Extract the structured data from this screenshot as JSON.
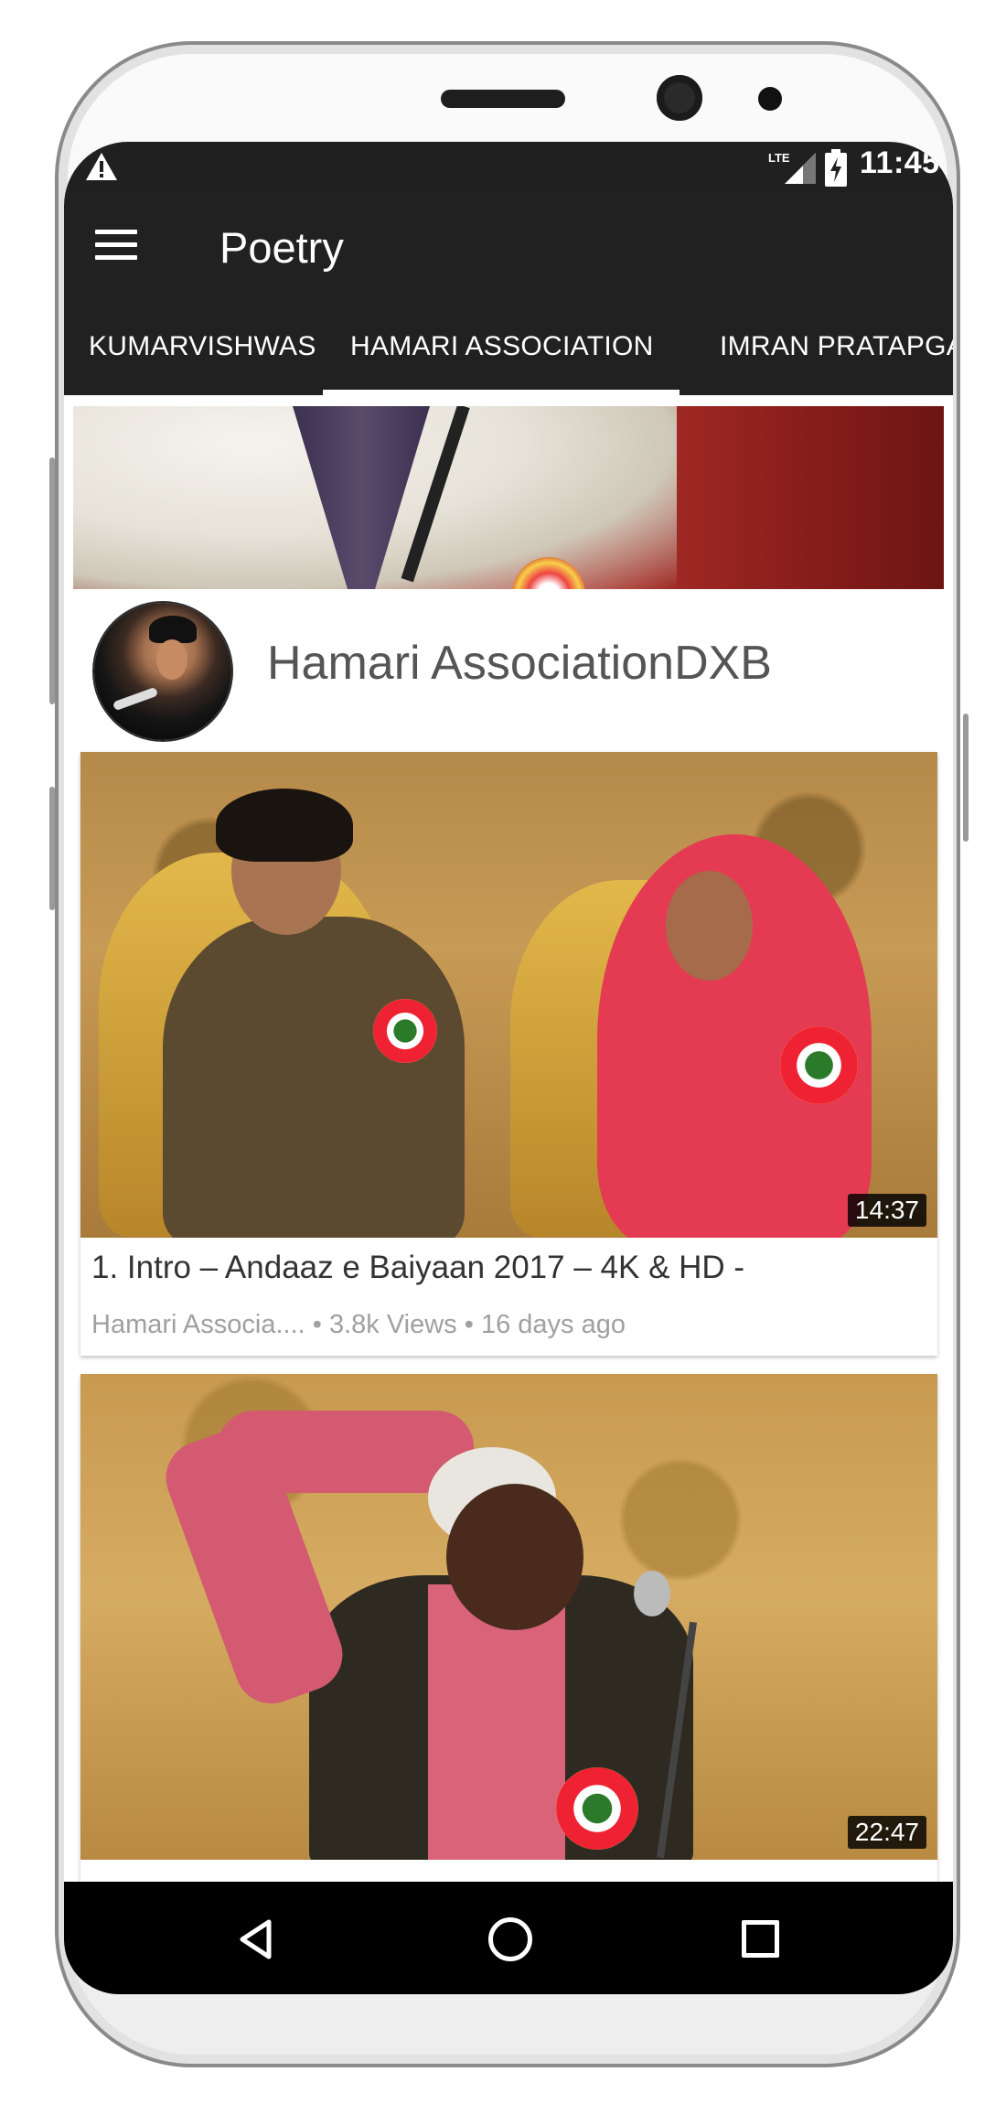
{
  "status_bar": {
    "time": "11:45",
    "icons": [
      "warning-icon",
      "lte-signal-icon",
      "battery-charging-icon"
    ]
  },
  "app_bar": {
    "title": "Poetry",
    "menu_icon": "hamburger-menu-icon"
  },
  "tabs": [
    {
      "label": "KUMARVISHWAS",
      "active": false
    },
    {
      "label": "HAMARI ASSOCIATION",
      "active": true
    },
    {
      "label": "IMRAN PRATAPGARHI",
      "active": false
    }
  ],
  "channel": {
    "name": "Hamari AssociationDXB"
  },
  "videos": [
    {
      "title": "1. Intro  – Andaaz e Baiyaan 2017 – 4K & HD -",
      "channel": "Hamari Associa....",
      "views": "3.8k Views",
      "age": "16 days ago",
      "duration": "14:37"
    },
    {
      "title": "",
      "duration": "22:47"
    }
  ],
  "meta_separator": "•",
  "nav_bar": {
    "icons": [
      "back-icon",
      "home-icon",
      "recent-apps-icon"
    ]
  },
  "colors": {
    "app_bar": "#212121",
    "status_bar": "#202020",
    "tab_indicator": "#ffffff",
    "duration_badge": "#000000"
  }
}
